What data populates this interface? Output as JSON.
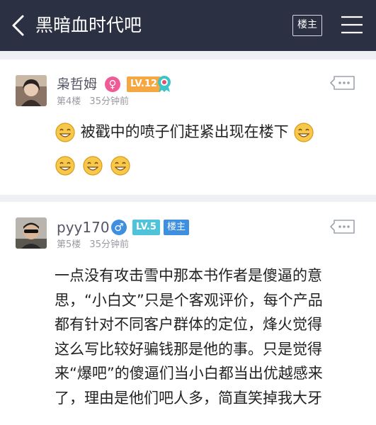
{
  "header": {
    "title": "黑暗血时代吧",
    "owner_button": "楼主",
    "colors": {
      "bar": "#2b3042"
    }
  },
  "posts": [
    {
      "username": "枭哲姆",
      "gender_icon": "♀",
      "level": "LV.12",
      "floor": "第4楼",
      "time": "35分钟前",
      "content": "被戳中的喷子们赶紧出现在楼下",
      "icons": [
        "female-icon",
        "level-badge",
        "medal-icon",
        "more-icon",
        "smiley-emoji"
      ]
    },
    {
      "username": "pyy170",
      "gender_icon": "♂",
      "level": "LV.5",
      "owner_tag": "楼主",
      "floor": "第5楼",
      "time": "35分钟前",
      "content_lines": [
        "一点没有攻击雪中那本书作者是傻逼的意",
        "思，“小白文”只是个客观评价，每个产品",
        "都有针对不同客户群体的定位，烽火觉得",
        "这么写比较好骗钱那是他的事。只是觉得",
        "来“爆吧”的傻逼们当小白都当出优越感来",
        "了，理由是他们吧人多，简直笑掉我大牙"
      ],
      "icons": [
        "male-icon",
        "level-badge",
        "owner-badge",
        "more-icon"
      ]
    }
  ]
}
